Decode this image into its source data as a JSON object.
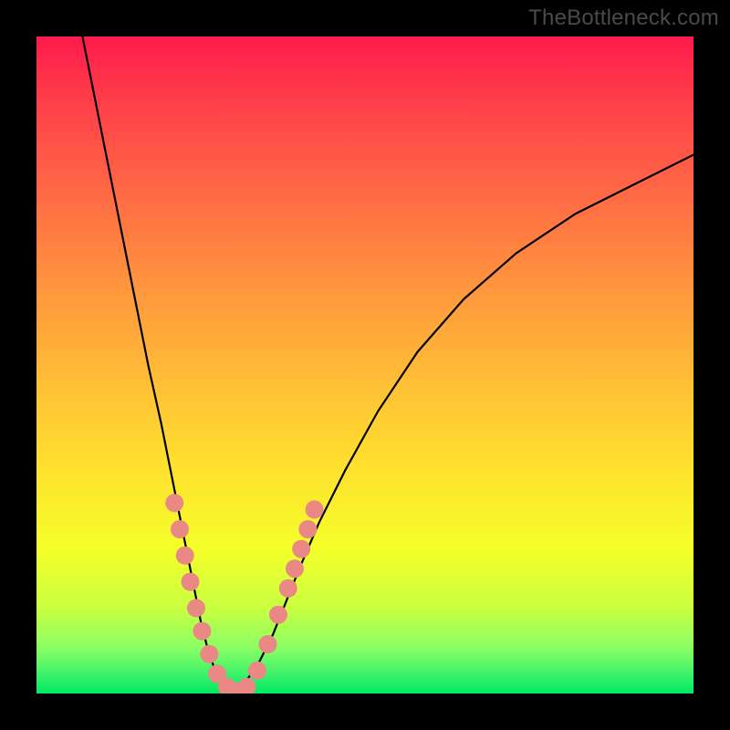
{
  "watermark": "TheBottleneck.com",
  "chart_data": {
    "type": "line",
    "title": "",
    "xlabel": "",
    "ylabel": "",
    "xlim": [
      0,
      100
    ],
    "ylim": [
      0,
      100
    ],
    "grid": false,
    "series": [
      {
        "name": "bottleneck-curve",
        "color": "#000000",
        "width": 2.2,
        "x": [
          7,
          9,
          11,
          13,
          15,
          17,
          19,
          20,
          21,
          22,
          23,
          24,
          25,
          26,
          27,
          28,
          29,
          30,
          31,
          32,
          34,
          36,
          38,
          40,
          43,
          47,
          52,
          58,
          65,
          73,
          82,
          92,
          100
        ],
        "y": [
          100,
          90,
          80,
          70,
          60,
          50,
          41,
          36,
          31,
          26,
          21,
          16,
          11,
          7,
          4,
          2,
          1,
          0.5,
          1,
          2,
          5,
          9,
          14,
          19,
          26,
          34,
          43,
          52,
          60,
          67,
          73,
          78,
          82
        ]
      }
    ],
    "overlay_points": {
      "name": "highlighted-dots",
      "color": "#e98885",
      "radius_px": 10,
      "x": [
        21.0,
        21.8,
        22.6,
        23.4,
        24.3,
        25.2,
        26.3,
        27.5,
        29.0,
        30.5,
        32.0,
        33.6,
        35.2,
        36.8,
        38.3,
        39.3,
        40.3,
        41.3,
        42.3
      ],
      "y": [
        29.0,
        25.0,
        21.0,
        17.0,
        13.0,
        9.5,
        6.0,
        3.0,
        1.0,
        0.3,
        1.0,
        3.5,
        7.5,
        12.0,
        16.0,
        19.0,
        22.0,
        25.0,
        28.0
      ]
    },
    "background_gradient": {
      "top": "#ff1a4b",
      "middle": "#ffe22e",
      "bottom": "#00e863"
    }
  }
}
